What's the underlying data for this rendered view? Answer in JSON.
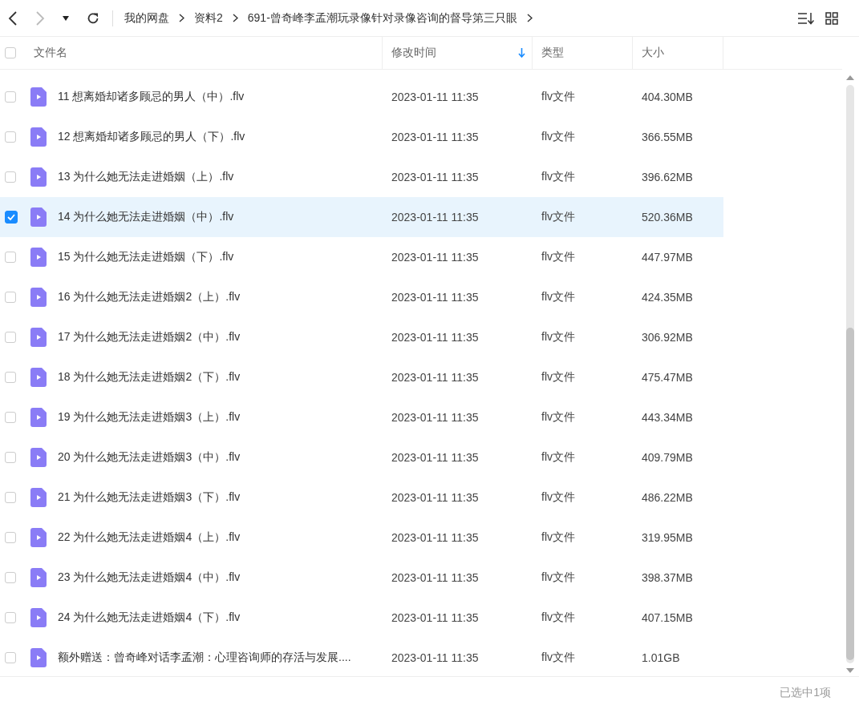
{
  "breadcrumb": [
    "我的网盘",
    "资料2",
    "691-曾奇峰李孟潮玩录像针对录像咨询的督导第三只眼"
  ],
  "columns": [
    {
      "label": "文件名",
      "sorted": false
    },
    {
      "label": "修改时间",
      "sorted": true
    },
    {
      "label": "类型",
      "sorted": false
    },
    {
      "label": "大小",
      "sorted": false
    }
  ],
  "select_all": {
    "checked": false
  },
  "rows": [
    {
      "name": "11 想离婚却诸多顾忌的男人（中）.flv",
      "modified": "2023-01-11 11:35",
      "type": "flv文件",
      "size": "404.30MB",
      "selected": false
    },
    {
      "name": "12 想离婚却诸多顾忌的男人（下）.flv",
      "modified": "2023-01-11 11:35",
      "type": "flv文件",
      "size": "366.55MB",
      "selected": false
    },
    {
      "name": "13 为什么她无法走进婚姻（上）.flv",
      "modified": "2023-01-11 11:35",
      "type": "flv文件",
      "size": "396.62MB",
      "selected": false
    },
    {
      "name": "14 为什么她无法走进婚姻（中）.flv",
      "modified": "2023-01-11 11:35",
      "type": "flv文件",
      "size": "520.36MB",
      "selected": true
    },
    {
      "name": "15 为什么她无法走进婚姻（下）.flv",
      "modified": "2023-01-11 11:35",
      "type": "flv文件",
      "size": "447.97MB",
      "selected": false
    },
    {
      "name": "16 为什么她无法走进婚姻2（上）.flv",
      "modified": "2023-01-11 11:35",
      "type": "flv文件",
      "size": "424.35MB",
      "selected": false
    },
    {
      "name": "17 为什么她无法走进婚姻2（中）.flv",
      "modified": "2023-01-11 11:35",
      "type": "flv文件",
      "size": "306.92MB",
      "selected": false
    },
    {
      "name": "18 为什么她无法走进婚姻2（下）.flv",
      "modified": "2023-01-11 11:35",
      "type": "flv文件",
      "size": "475.47MB",
      "selected": false
    },
    {
      "name": "19 为什么她无法走进婚姻3（上）.flv",
      "modified": "2023-01-11 11:35",
      "type": "flv文件",
      "size": "443.34MB",
      "selected": false
    },
    {
      "name": "20 为什么她无法走进婚姻3（中）.flv",
      "modified": "2023-01-11 11:35",
      "type": "flv文件",
      "size": "409.79MB",
      "selected": false
    },
    {
      "name": "21 为什么她无法走进婚姻3（下）.flv",
      "modified": "2023-01-11 11:35",
      "type": "flv文件",
      "size": "486.22MB",
      "selected": false
    },
    {
      "name": "22 为什么她无法走进婚姻4（上）.flv",
      "modified": "2023-01-11 11:35",
      "type": "flv文件",
      "size": "319.95MB",
      "selected": false
    },
    {
      "name": "23 为什么她无法走进婚姻4（中）.flv",
      "modified": "2023-01-11 11:35",
      "type": "flv文件",
      "size": "398.37MB",
      "selected": false
    },
    {
      "name": "24 为什么她无法走进婚姻4（下）.flv",
      "modified": "2023-01-11 11:35",
      "type": "flv文件",
      "size": "407.15MB",
      "selected": false
    },
    {
      "name": "额外赠送：曾奇峰对话李孟潮：心理咨询师的存活与发展....",
      "modified": "2023-01-11 11:35",
      "type": "flv文件",
      "size": "1.01GB",
      "selected": false
    }
  ],
  "status": "已选中1项"
}
